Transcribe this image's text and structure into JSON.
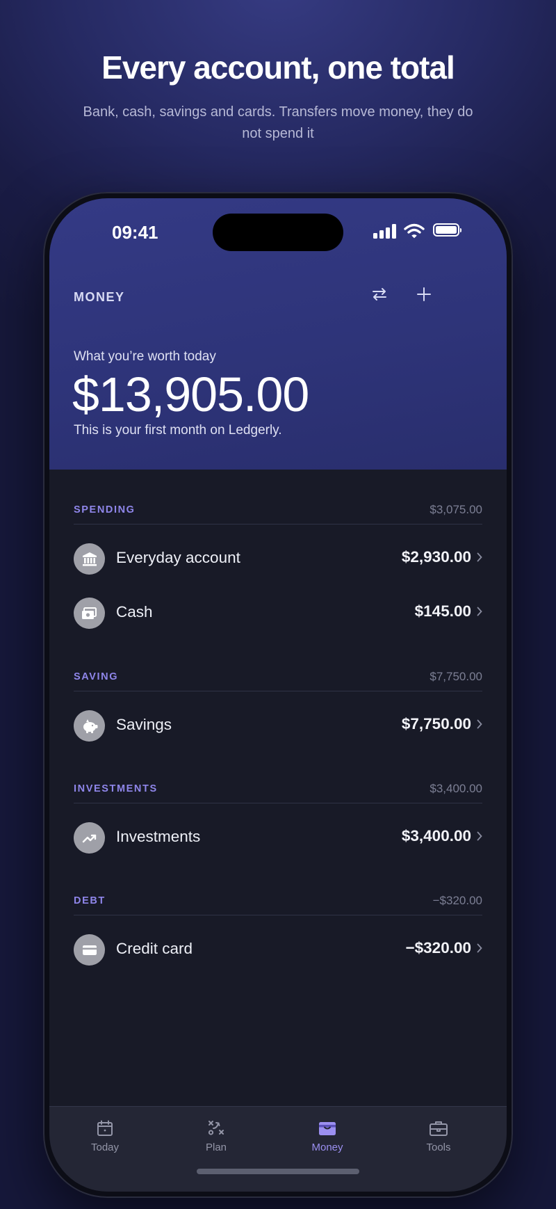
{
  "promo": {
    "title": "Every account, one total",
    "subtitle": "Bank, cash, savings and cards. Transfers move money, they do not spend it"
  },
  "status_bar": {
    "time": "09:41",
    "icons": [
      "signal-icon",
      "wifi-icon",
      "battery-icon"
    ]
  },
  "header": {
    "title": "MONEY",
    "actions": [
      "transfer-icon",
      "add-icon"
    ]
  },
  "summary": {
    "label": "What you’re worth today",
    "amount": "$13,905.00",
    "note": "This is your first month on Ledgerly."
  },
  "groups": [
    {
      "label": "SPENDING",
      "total": "$3,075.00",
      "accounts": [
        {
          "name": "Everyday account",
          "amount": "$2,930.00",
          "icon": "bank-icon"
        },
        {
          "name": "Cash",
          "amount": "$145.00",
          "icon": "cash-icon"
        }
      ]
    },
    {
      "label": "SAVING",
      "total": "$7,750.00",
      "accounts": [
        {
          "name": "Savings",
          "amount": "$7,750.00",
          "icon": "piggy-bank-icon"
        }
      ]
    },
    {
      "label": "INVESTMENTS",
      "total": "$3,400.00",
      "accounts": [
        {
          "name": "Investments",
          "amount": "$3,400.00",
          "icon": "trending-up-icon"
        }
      ]
    },
    {
      "label": "DEBT",
      "total": "−$320.00",
      "accounts": [
        {
          "name": "Credit card",
          "amount": "−$320.00",
          "icon": "credit-card-icon"
        }
      ]
    }
  ],
  "tabs": [
    {
      "label": "Today",
      "icon": "calendar-icon",
      "active": false
    },
    {
      "label": "Plan",
      "icon": "strategy-icon",
      "active": false
    },
    {
      "label": "Money",
      "icon": "wallet-icon",
      "active": true
    },
    {
      "label": "Tools",
      "icon": "toolbox-icon",
      "active": false
    }
  ],
  "colors": {
    "accent": "#9b8ff0",
    "hero": "#2e3479",
    "surface": "#181a27",
    "tabbar": "#242635"
  }
}
